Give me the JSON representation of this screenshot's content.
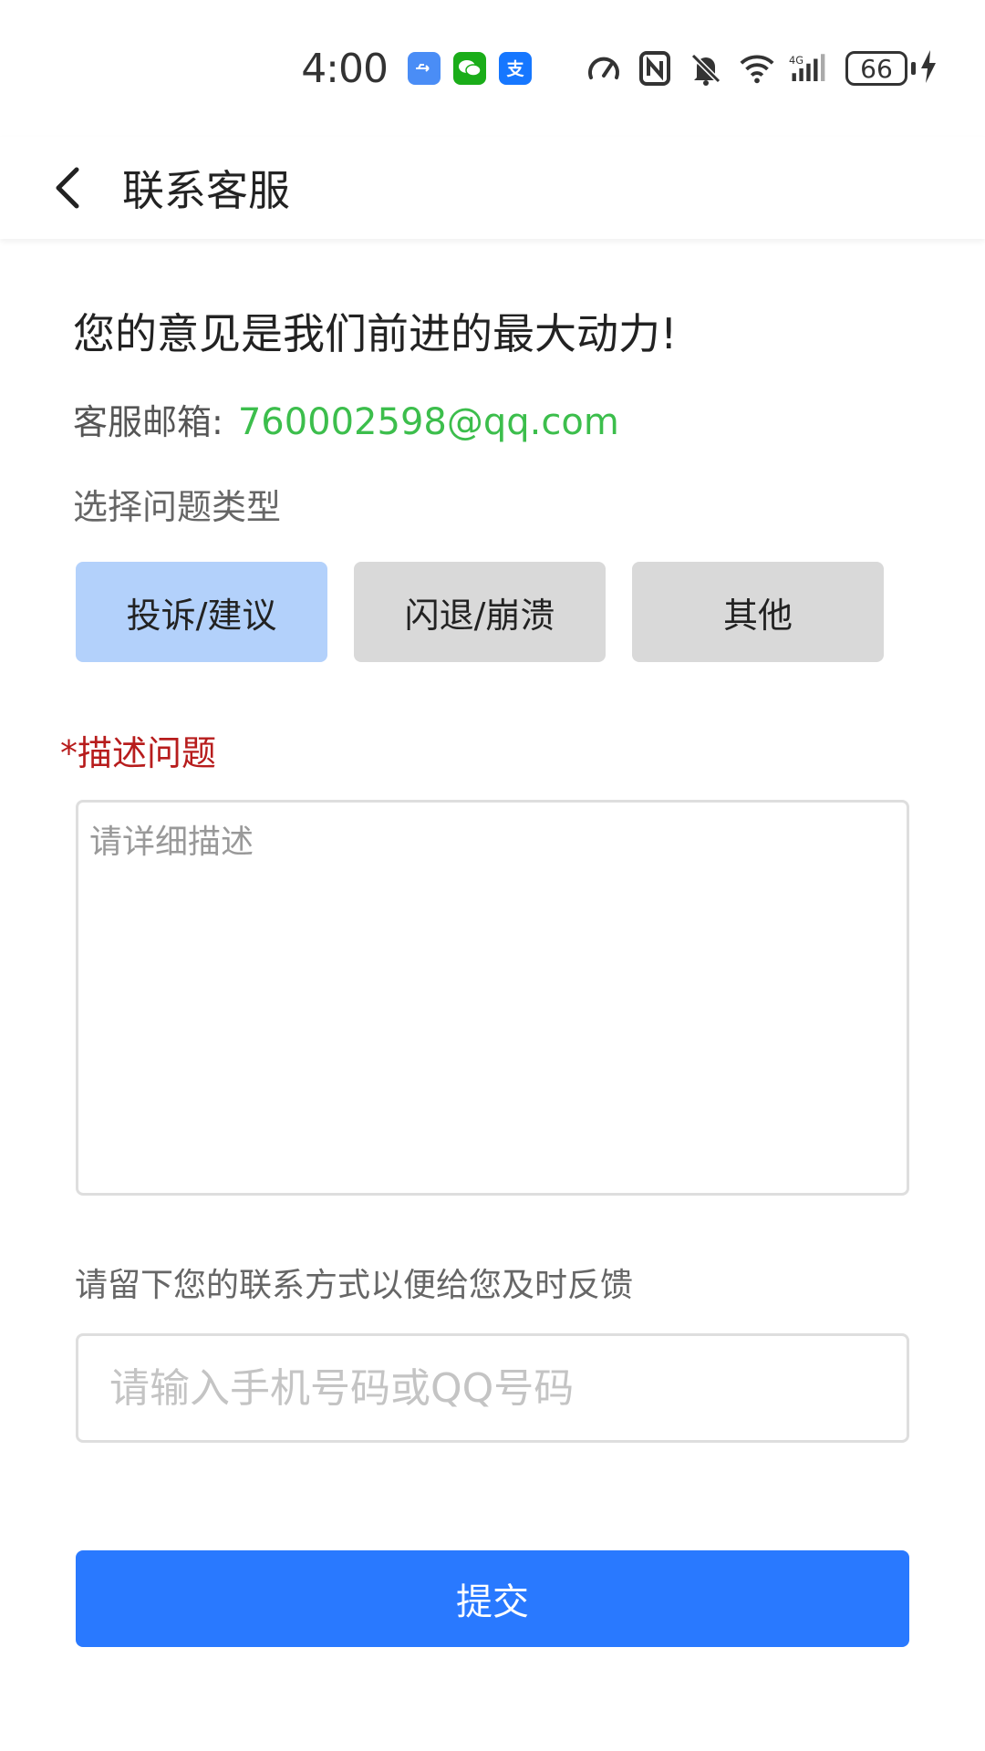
{
  "status_bar": {
    "time": "4:00",
    "notification_icons": [
      {
        "name": "usb-icon",
        "color": "#4a8df6",
        "glyph": "⇌"
      },
      {
        "name": "wechat-icon",
        "color": "#1aad19",
        "glyph": "✉"
      },
      {
        "name": "alipay-icon",
        "color": "#1677ff",
        "glyph": "支"
      }
    ],
    "battery_level": "66"
  },
  "header": {
    "title": "联系客服"
  },
  "slogan": "您的意见是我们前进的最大动力!",
  "email": {
    "label": "客服邮箱:",
    "value": "760002598@qq.com",
    "color": "#3cbe4c"
  },
  "problem_type": {
    "label": "选择问题类型",
    "options": [
      "投诉/建议",
      "闪退/崩溃",
      "其他"
    ],
    "selected": "投诉/建议"
  },
  "description": {
    "label": "*描述问题",
    "placeholder": "请详细描述"
  },
  "contact": {
    "label": "请留下您的联系方式以便给您及时反馈",
    "placeholder": "请输入手机号码或QQ号码"
  },
  "submit": {
    "label": "提交",
    "color": "#2979ff"
  }
}
